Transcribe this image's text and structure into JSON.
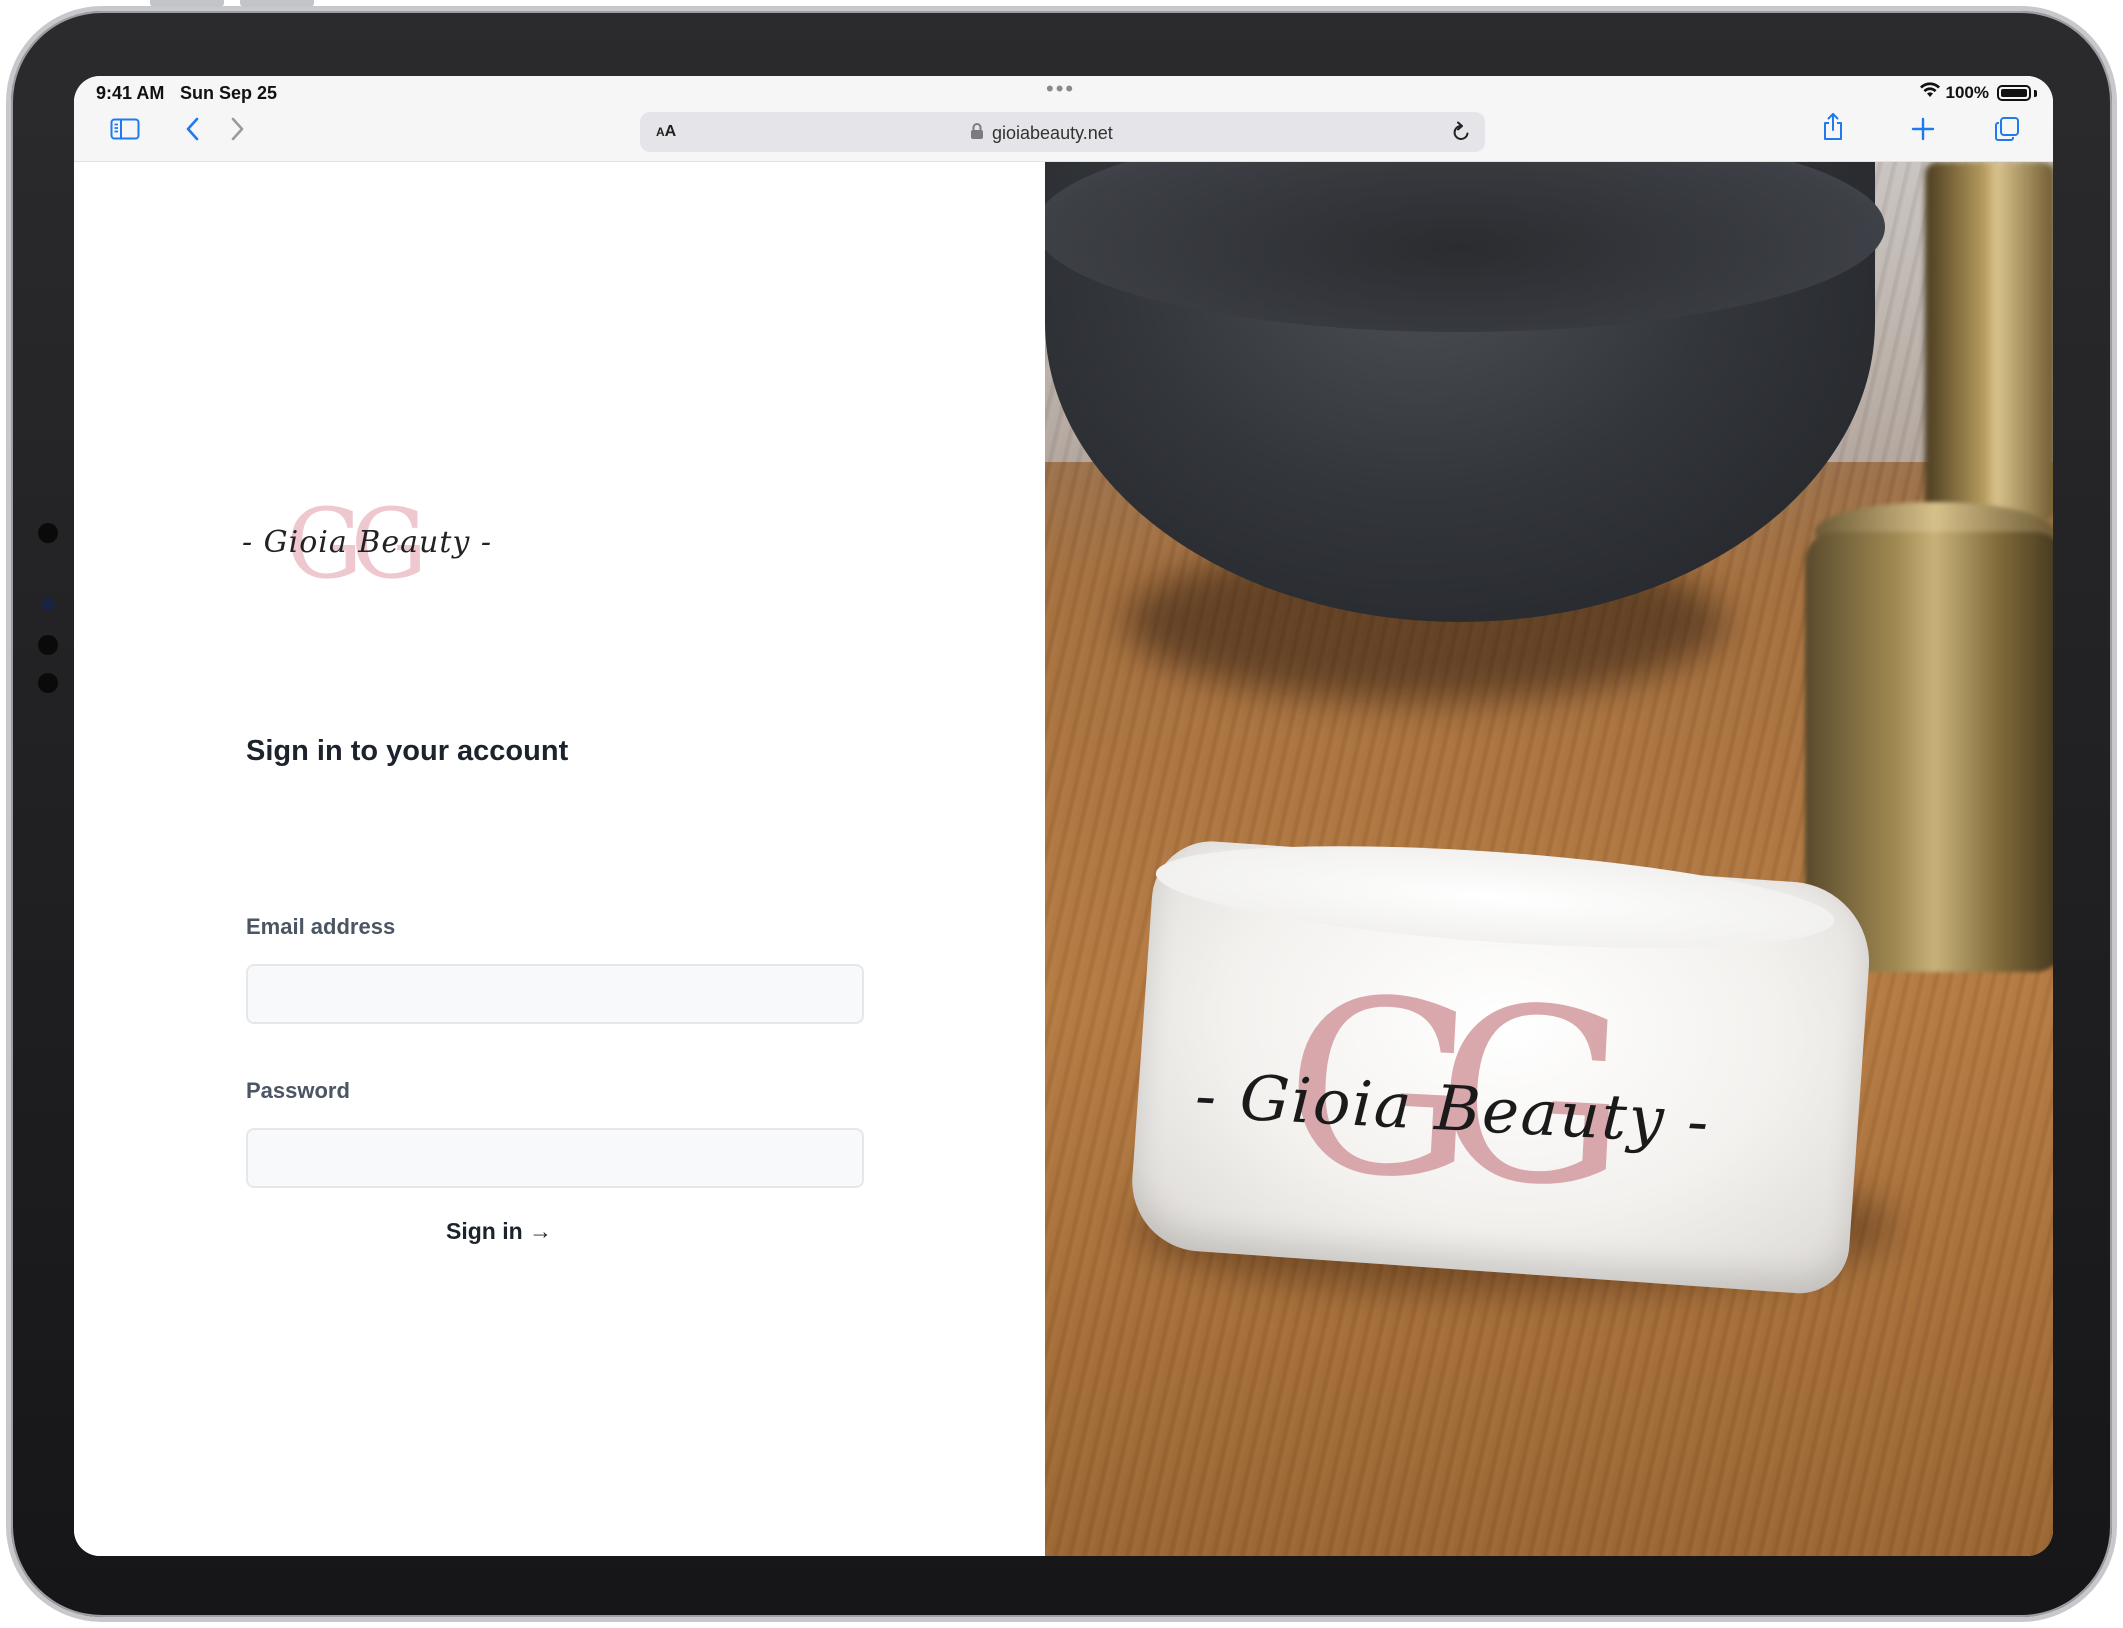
{
  "statusbar": {
    "time": "9:41 AM",
    "date": "Sun Sep 25",
    "battery_percent": "100%",
    "battery_level": 1.0
  },
  "browser": {
    "aa_label": "AA",
    "url": "gioiabeauty.net",
    "icons": [
      "sidebar-icon",
      "back-icon",
      "forward-icon",
      "lock-icon",
      "reload-icon",
      "share-icon",
      "new-tab-icon",
      "tabs-icon"
    ]
  },
  "logo": {
    "monogram": "GG",
    "brand": "- Gioia Beauty -"
  },
  "form": {
    "title": "Sign in to your account",
    "email_label": "Email address",
    "email_value": "",
    "password_label": "Password",
    "password_value": "",
    "submit_label": "Sign in →"
  },
  "photo": {
    "towel_monogram": "GG",
    "towel_brand": "- Gioia Beauty -"
  },
  "colors": {
    "text_primary": "#1d232c",
    "label": "#4b5563",
    "field_bg": "#f8f9fa",
    "field_border": "#e5e7eb",
    "monogram_pink": "#eec7cf",
    "accent_blue": "#1f7af0"
  }
}
